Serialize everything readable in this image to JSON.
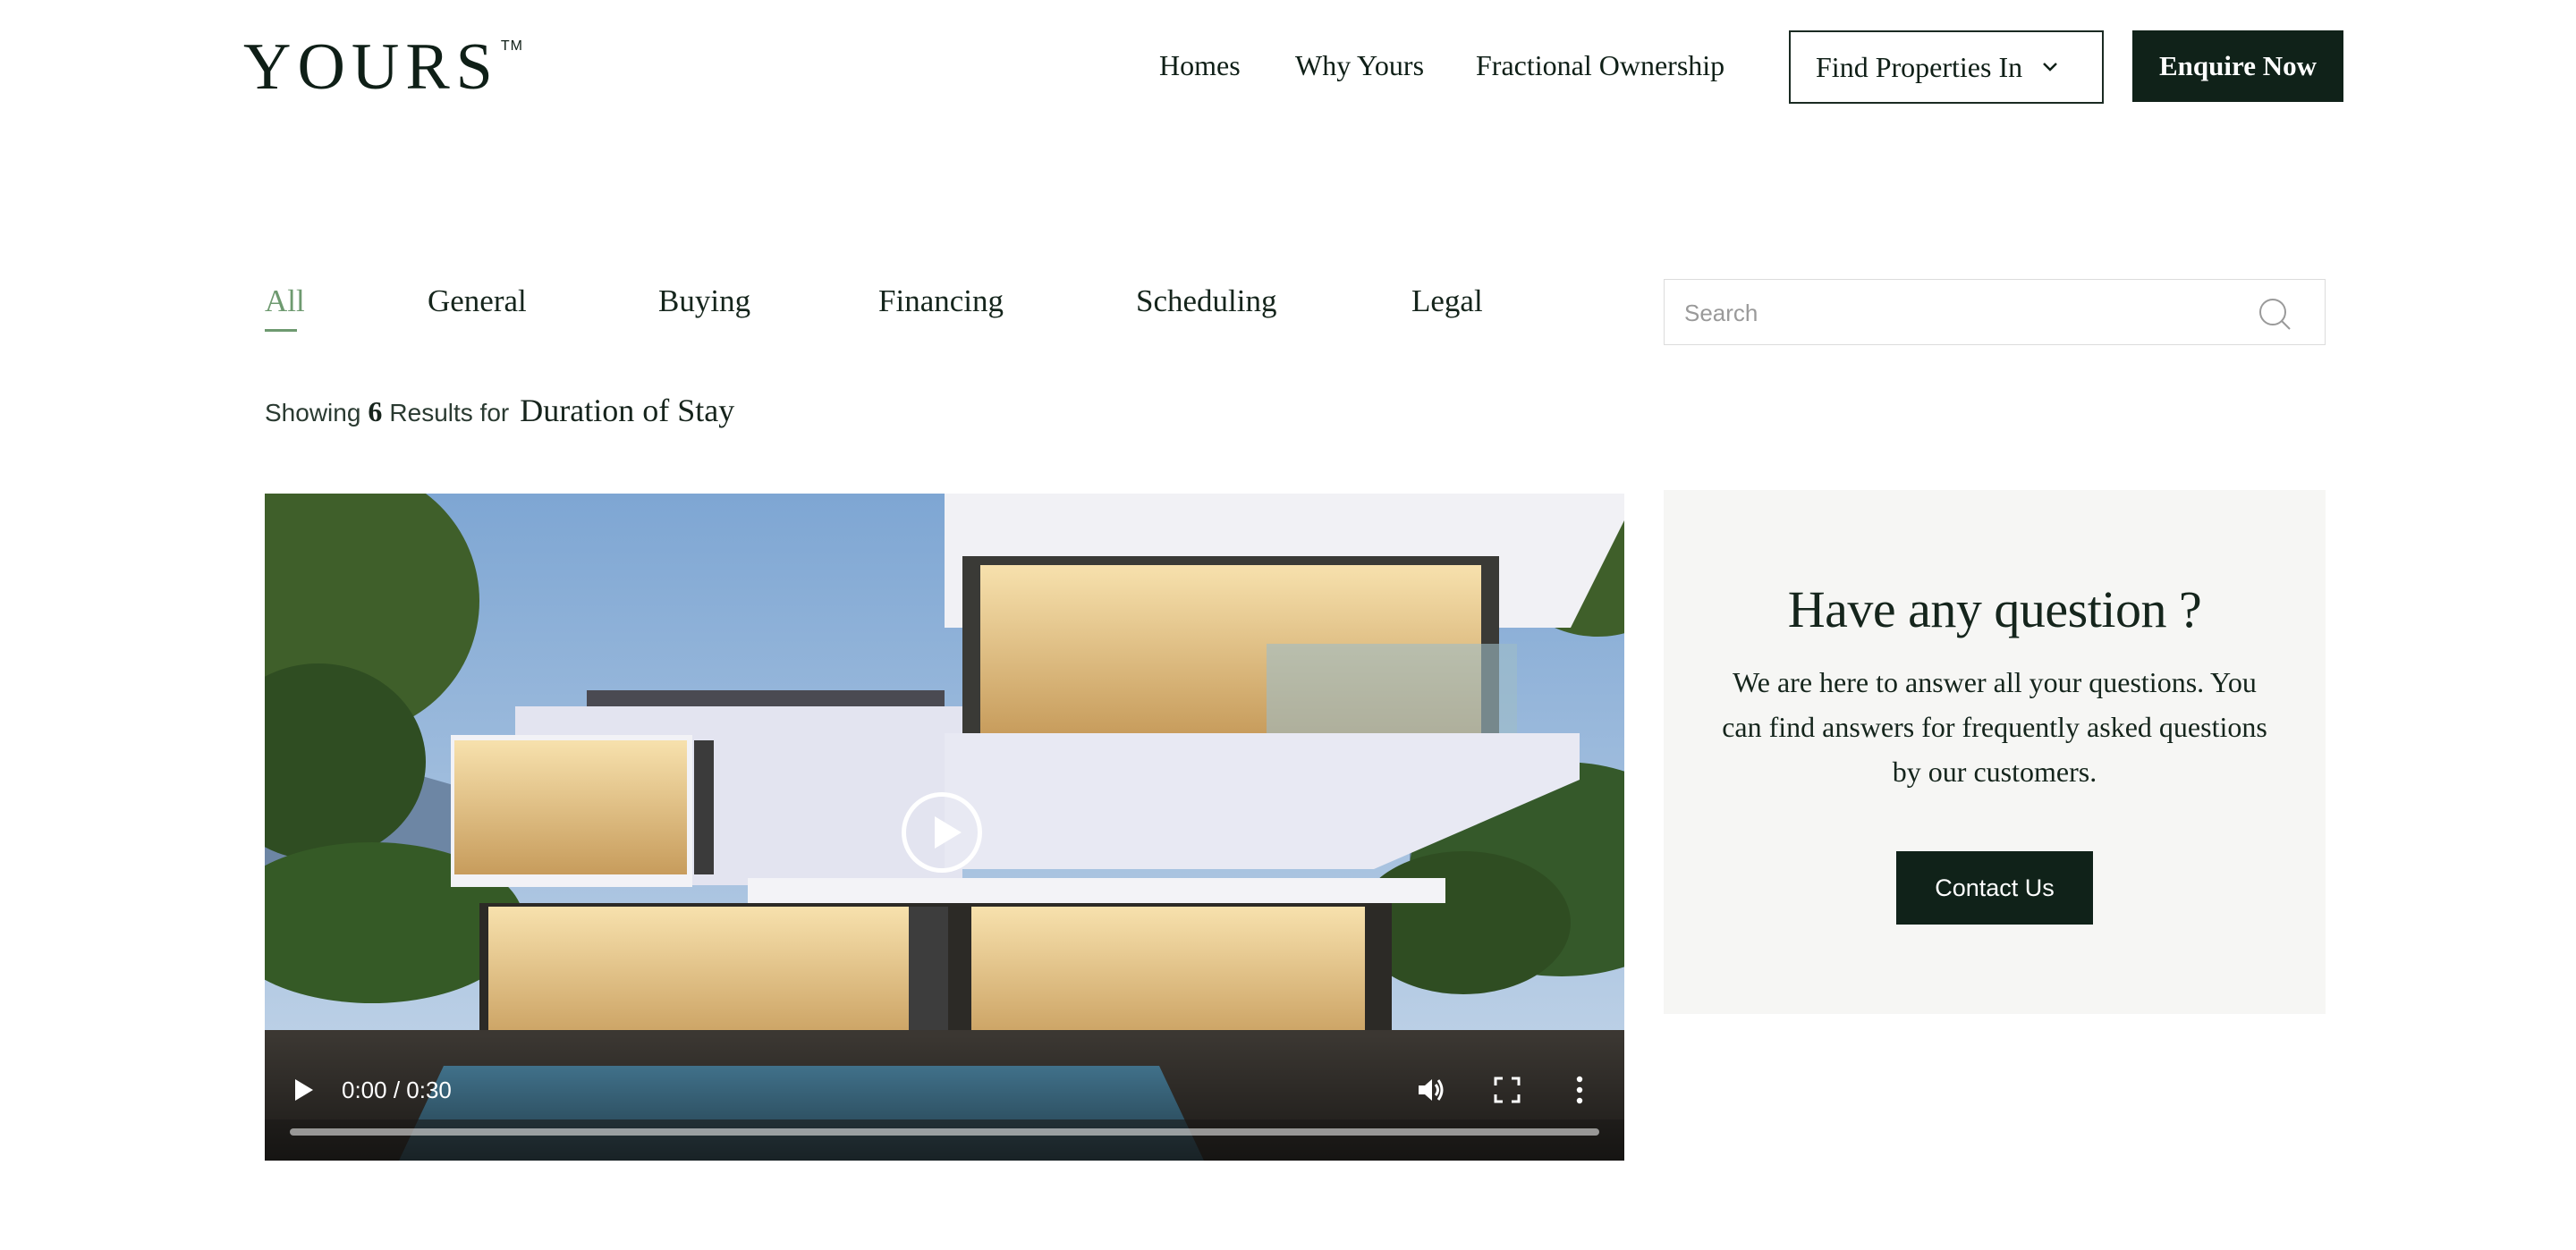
{
  "header": {
    "logo_text": "YOURS",
    "logo_tm": "TM",
    "nav": [
      "Homes",
      "Why Yours",
      "Fractional Ownership"
    ],
    "find_label": "Find Properties In",
    "enquire_label": "Enquire Now"
  },
  "tabs": [
    "All",
    "General",
    "Buying",
    "Financing",
    "Scheduling",
    "Legal"
  ],
  "active_tab": "All",
  "search": {
    "placeholder": "Search",
    "value": ""
  },
  "results": {
    "prefix": "Showing",
    "count": "6",
    "middle": "Results for",
    "query": "Duration of Stay"
  },
  "video": {
    "time": "0:00 / 0:30",
    "icons": [
      "play-icon",
      "volume-icon",
      "fullscreen-icon",
      "more-options-icon"
    ]
  },
  "question_panel": {
    "title": "Have any question ?",
    "text": "We are here to answer all your questions. You can find answers for frequently asked questions by our customers.",
    "button": "Contact Us"
  },
  "colors": {
    "brand_dark": "#102219",
    "accent_green": "#6e9a70",
    "panel_bg": "#f6f6f4"
  }
}
